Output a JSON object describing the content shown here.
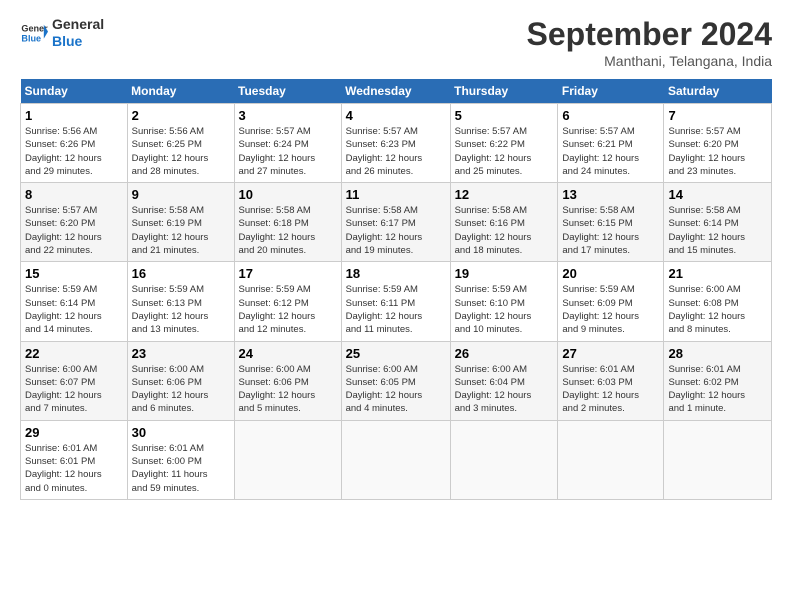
{
  "logo": {
    "line1": "General",
    "line2": "Blue"
  },
  "title": "September 2024",
  "subtitle": "Manthani, Telangana, India",
  "days_header": [
    "Sunday",
    "Monday",
    "Tuesday",
    "Wednesday",
    "Thursday",
    "Friday",
    "Saturday"
  ],
  "weeks": [
    [
      {
        "num": "1",
        "info": "Sunrise: 5:56 AM\nSunset: 6:26 PM\nDaylight: 12 hours\nand 29 minutes."
      },
      {
        "num": "2",
        "info": "Sunrise: 5:56 AM\nSunset: 6:25 PM\nDaylight: 12 hours\nand 28 minutes."
      },
      {
        "num": "3",
        "info": "Sunrise: 5:57 AM\nSunset: 6:24 PM\nDaylight: 12 hours\nand 27 minutes."
      },
      {
        "num": "4",
        "info": "Sunrise: 5:57 AM\nSunset: 6:23 PM\nDaylight: 12 hours\nand 26 minutes."
      },
      {
        "num": "5",
        "info": "Sunrise: 5:57 AM\nSunset: 6:22 PM\nDaylight: 12 hours\nand 25 minutes."
      },
      {
        "num": "6",
        "info": "Sunrise: 5:57 AM\nSunset: 6:21 PM\nDaylight: 12 hours\nand 24 minutes."
      },
      {
        "num": "7",
        "info": "Sunrise: 5:57 AM\nSunset: 6:20 PM\nDaylight: 12 hours\nand 23 minutes."
      }
    ],
    [
      {
        "num": "8",
        "info": "Sunrise: 5:57 AM\nSunset: 6:20 PM\nDaylight: 12 hours\nand 22 minutes."
      },
      {
        "num": "9",
        "info": "Sunrise: 5:58 AM\nSunset: 6:19 PM\nDaylight: 12 hours\nand 21 minutes."
      },
      {
        "num": "10",
        "info": "Sunrise: 5:58 AM\nSunset: 6:18 PM\nDaylight: 12 hours\nand 20 minutes."
      },
      {
        "num": "11",
        "info": "Sunrise: 5:58 AM\nSunset: 6:17 PM\nDaylight: 12 hours\nand 19 minutes."
      },
      {
        "num": "12",
        "info": "Sunrise: 5:58 AM\nSunset: 6:16 PM\nDaylight: 12 hours\nand 18 minutes."
      },
      {
        "num": "13",
        "info": "Sunrise: 5:58 AM\nSunset: 6:15 PM\nDaylight: 12 hours\nand 17 minutes."
      },
      {
        "num": "14",
        "info": "Sunrise: 5:58 AM\nSunset: 6:14 PM\nDaylight: 12 hours\nand 15 minutes."
      }
    ],
    [
      {
        "num": "15",
        "info": "Sunrise: 5:59 AM\nSunset: 6:14 PM\nDaylight: 12 hours\nand 14 minutes."
      },
      {
        "num": "16",
        "info": "Sunrise: 5:59 AM\nSunset: 6:13 PM\nDaylight: 12 hours\nand 13 minutes."
      },
      {
        "num": "17",
        "info": "Sunrise: 5:59 AM\nSunset: 6:12 PM\nDaylight: 12 hours\nand 12 minutes."
      },
      {
        "num": "18",
        "info": "Sunrise: 5:59 AM\nSunset: 6:11 PM\nDaylight: 12 hours\nand 11 minutes."
      },
      {
        "num": "19",
        "info": "Sunrise: 5:59 AM\nSunset: 6:10 PM\nDaylight: 12 hours\nand 10 minutes."
      },
      {
        "num": "20",
        "info": "Sunrise: 5:59 AM\nSunset: 6:09 PM\nDaylight: 12 hours\nand 9 minutes."
      },
      {
        "num": "21",
        "info": "Sunrise: 6:00 AM\nSunset: 6:08 PM\nDaylight: 12 hours\nand 8 minutes."
      }
    ],
    [
      {
        "num": "22",
        "info": "Sunrise: 6:00 AM\nSunset: 6:07 PM\nDaylight: 12 hours\nand 7 minutes."
      },
      {
        "num": "23",
        "info": "Sunrise: 6:00 AM\nSunset: 6:06 PM\nDaylight: 12 hours\nand 6 minutes."
      },
      {
        "num": "24",
        "info": "Sunrise: 6:00 AM\nSunset: 6:06 PM\nDaylight: 12 hours\nand 5 minutes."
      },
      {
        "num": "25",
        "info": "Sunrise: 6:00 AM\nSunset: 6:05 PM\nDaylight: 12 hours\nand 4 minutes."
      },
      {
        "num": "26",
        "info": "Sunrise: 6:00 AM\nSunset: 6:04 PM\nDaylight: 12 hours\nand 3 minutes."
      },
      {
        "num": "27",
        "info": "Sunrise: 6:01 AM\nSunset: 6:03 PM\nDaylight: 12 hours\nand 2 minutes."
      },
      {
        "num": "28",
        "info": "Sunrise: 6:01 AM\nSunset: 6:02 PM\nDaylight: 12 hours\nand 1 minute."
      }
    ],
    [
      {
        "num": "29",
        "info": "Sunrise: 6:01 AM\nSunset: 6:01 PM\nDaylight: 12 hours\nand 0 minutes."
      },
      {
        "num": "30",
        "info": "Sunrise: 6:01 AM\nSunset: 6:00 PM\nDaylight: 11 hours\nand 59 minutes."
      },
      null,
      null,
      null,
      null,
      null
    ]
  ]
}
